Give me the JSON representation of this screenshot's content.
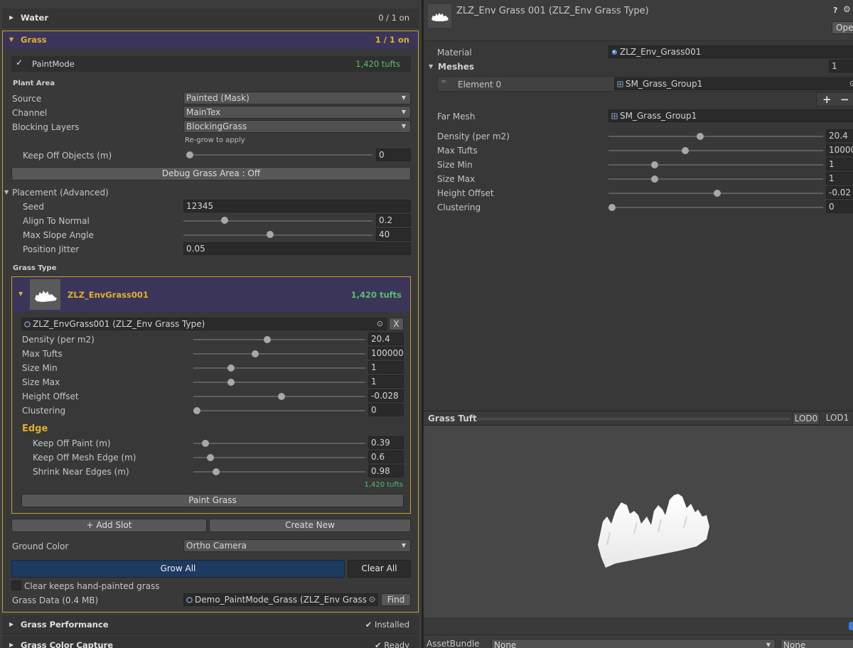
{
  "left": {
    "water": {
      "title": "Water",
      "status": "0 / 1 on"
    },
    "grass": {
      "title": "Grass",
      "status": "1 / 1 on",
      "paint_mode": {
        "label": "PaintMode",
        "checked": true,
        "tufts": "1,420 tufts"
      },
      "plant_area": {
        "heading": "Plant Area",
        "source_label": "Source",
        "source_value": "Painted (Mask)",
        "channel_label": "Channel",
        "channel_value": "MainTex",
        "blocking_label": "Blocking Layers",
        "blocking_value": "BlockingGrass",
        "regrow_hint": "Re-grow to apply",
        "keep_off_label": "Keep Off Objects (m)",
        "keep_off_value": "0",
        "keep_off_fraction": 0.0,
        "debug_button": "Debug Grass Area : Off"
      },
      "placement": {
        "heading": "Placement (Advanced)",
        "seed_label": "Seed",
        "seed_value": "12345",
        "align_label": "Align To Normal",
        "align_value": "0.2",
        "align_fraction": 0.2,
        "slope_label": "Max Slope Angle",
        "slope_value": "40",
        "slope_fraction": 0.44,
        "jitter_label": "Position Jitter",
        "jitter_value": "0.05"
      },
      "grass_type": {
        "heading": "Grass Type",
        "slot_name": "ZLZ_EnvGrass001",
        "slot_tufts": "1,420 tufts",
        "asset_ref": "ZLZ_EnvGrass001 (ZLZ_Env Grass Type)",
        "clear_button": "X",
        "params": [
          {
            "label": "Density (per m2)",
            "value": "20.4",
            "fraction": 0.41
          },
          {
            "label": "Max Tufts",
            "value": "100000",
            "fraction": 0.34
          },
          {
            "label": "Size Min",
            "value": "1",
            "fraction": 0.2
          },
          {
            "label": "Size Max",
            "value": "1",
            "fraction": 0.2
          },
          {
            "label": "Height Offset",
            "value": "-0.028",
            "fraction": 0.49
          },
          {
            "label": "Clustering",
            "value": "0",
            "fraction": 0.0
          }
        ],
        "edge_heading": "Edge",
        "edge_params": [
          {
            "label": "Keep Off Paint (m)",
            "value": "0.39",
            "fraction": 0.05
          },
          {
            "label": "Keep Off Mesh Edge (m)",
            "value": "0.6",
            "fraction": 0.08
          },
          {
            "label": "Shrink Near Edges (m)",
            "value": "0.98",
            "fraction": 0.11
          }
        ],
        "footer_tufts": "1,420 tufts",
        "paint_button": "Paint Grass"
      },
      "add_slot_button": "+ Add Slot",
      "create_new_button": "Create New",
      "ground_color_label": "Ground Color",
      "ground_color_value": "Ortho Camera",
      "grow_all_button": "Grow All",
      "clear_all_button": "Clear All",
      "clear_keeps_label": "Clear keeps hand-painted grass",
      "clear_keeps_checked": false,
      "grass_data_label": "Grass Data (0.4 MB)",
      "grass_data_value": "Demo_PaintMode_Grass (ZLZ_Env Grass D",
      "find_button": "Find"
    },
    "performance": {
      "title": "Grass Performance",
      "status": "Installed"
    },
    "color_capture": {
      "title": "Grass Color Capture",
      "status": "Ready"
    }
  },
  "right": {
    "title": "ZLZ_Env Grass 001 (ZLZ_Env Grass Type)",
    "open_button": "Ope",
    "material_label": "Material",
    "material_value": "ZLZ_Env_Grass001",
    "meshes_label": "Meshes",
    "meshes_count": "1",
    "element_label": "Element 0",
    "element_value": "SM_Grass_Group1",
    "plus": "+",
    "minus": "−",
    "far_mesh_label": "Far Mesh",
    "far_mesh_value": "SM_Grass_Group1",
    "params": [
      {
        "label": "Density (per m2)",
        "value": "20.4",
        "fraction": 0.41
      },
      {
        "label": "Max Tufts",
        "value": "10000",
        "fraction": 0.34
      },
      {
        "label": "Size Min",
        "value": "1",
        "fraction": 0.2
      },
      {
        "label": "Size Max",
        "value": "1",
        "fraction": 0.2
      },
      {
        "label": "Height Offset",
        "value": "-0.02",
        "fraction": 0.49
      },
      {
        "label": "Clustering",
        "value": "0",
        "fraction": 0.0
      }
    ],
    "preview_title": "Grass Tuft",
    "lod0": "LOD0",
    "lod1": "LOD1",
    "assetbundle_label": "AssetBundle",
    "assetbundle_value": "None",
    "assetbundle_variant": "None"
  }
}
